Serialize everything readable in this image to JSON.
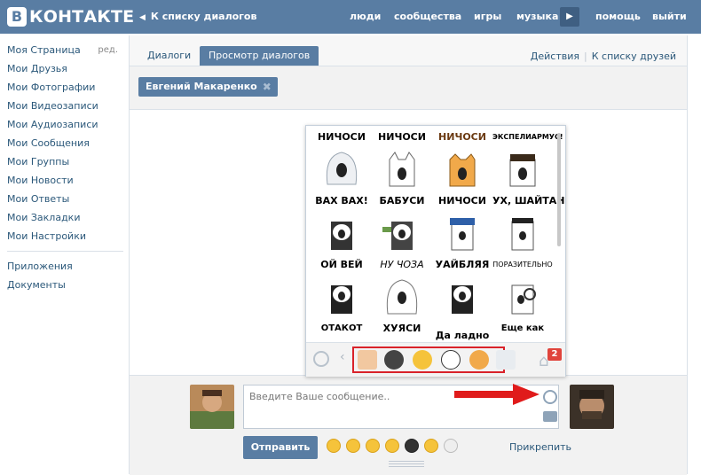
{
  "header": {
    "logo_mark": "В",
    "logo_text": "КОНТАКТЕ",
    "back_label": "К списку диалогов",
    "nav": [
      "люди",
      "сообщества",
      "игры",
      "музыка",
      "помощь",
      "выйти"
    ]
  },
  "sidebar": {
    "items": [
      "Моя Страница",
      "Мои Друзья",
      "Мои Фотографии",
      "Мои Видеозаписи",
      "Мои Аудиозаписи",
      "Мои Сообщения",
      "Мои Группы",
      "Мои Новости",
      "Мои Ответы",
      "Мои Закладки",
      "Мои Настройки"
    ],
    "edit_label": "ред.",
    "extra": [
      "Приложения",
      "Документы"
    ]
  },
  "tabs": {
    "items": [
      "Диалоги",
      "Просмотр диалогов"
    ],
    "active_index": 1
  },
  "right_links": [
    "Действия",
    "К списку друзей"
  ],
  "recipient": {
    "name": "Евгений Макаренко"
  },
  "sticker_panel": {
    "captions": [
      "НИЧОСИ",
      "НИЧОСИ",
      "НИЧОСИ",
      "ЭКСПЕЛИАРМУС!",
      "ВАХ ВАХ!",
      "БАБУСИ",
      "НИЧОСИ",
      "УХ, ШАЙТАН",
      "ОЙ ВЕЙ",
      "НУ ЧОЗА",
      "УАЙБЛЯЯ",
      "ПОРАЗИТЕЛЬНО",
      "ОТАКОТ",
      "ХУЯСИ",
      "Да ладно",
      "Еще как"
    ],
    "badge_count": "2"
  },
  "composer": {
    "placeholder": "Введите Ваше сообщение..",
    "send_label": "Отправить",
    "attach_label": "Прикрепить"
  },
  "colors": {
    "brand": "#597da3",
    "link": "#2b587a",
    "highlight": "#d9222a"
  }
}
